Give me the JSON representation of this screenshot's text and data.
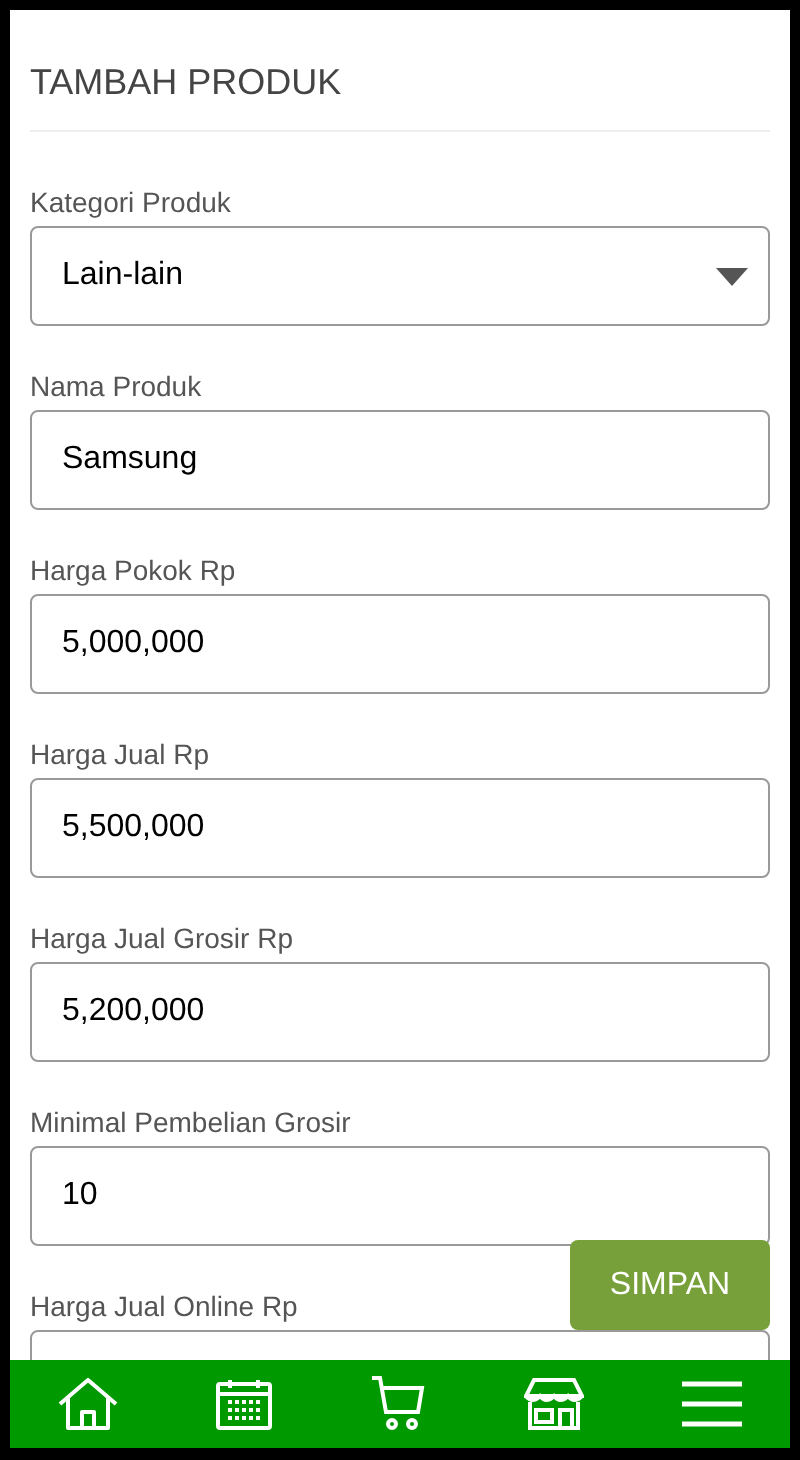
{
  "title": "TAMBAH PRODUK",
  "fields": [
    {
      "label": "Kategori Produk",
      "kind": "select",
      "value": "Lain-lain"
    },
    {
      "label": "Nama Produk",
      "kind": "text",
      "value": "Samsung"
    },
    {
      "label": "Harga Pokok Rp",
      "kind": "text",
      "value": "5,000,000"
    },
    {
      "label": "Harga Jual Rp",
      "kind": "text",
      "value": "5,500,000"
    },
    {
      "label": "Harga Jual Grosir Rp",
      "kind": "text",
      "value": "5,200,000"
    },
    {
      "label": "Minimal Pembelian Grosir",
      "kind": "text",
      "value": "10"
    },
    {
      "label": "Harga Jual Online Rp",
      "kind": "text"
    }
  ],
  "save_button": "SIMPAN",
  "nav": [
    {
      "kind": "home"
    },
    {
      "kind": "calendar"
    },
    {
      "kind": "cart"
    },
    {
      "kind": "store"
    },
    {
      "kind": "menu"
    }
  ]
}
